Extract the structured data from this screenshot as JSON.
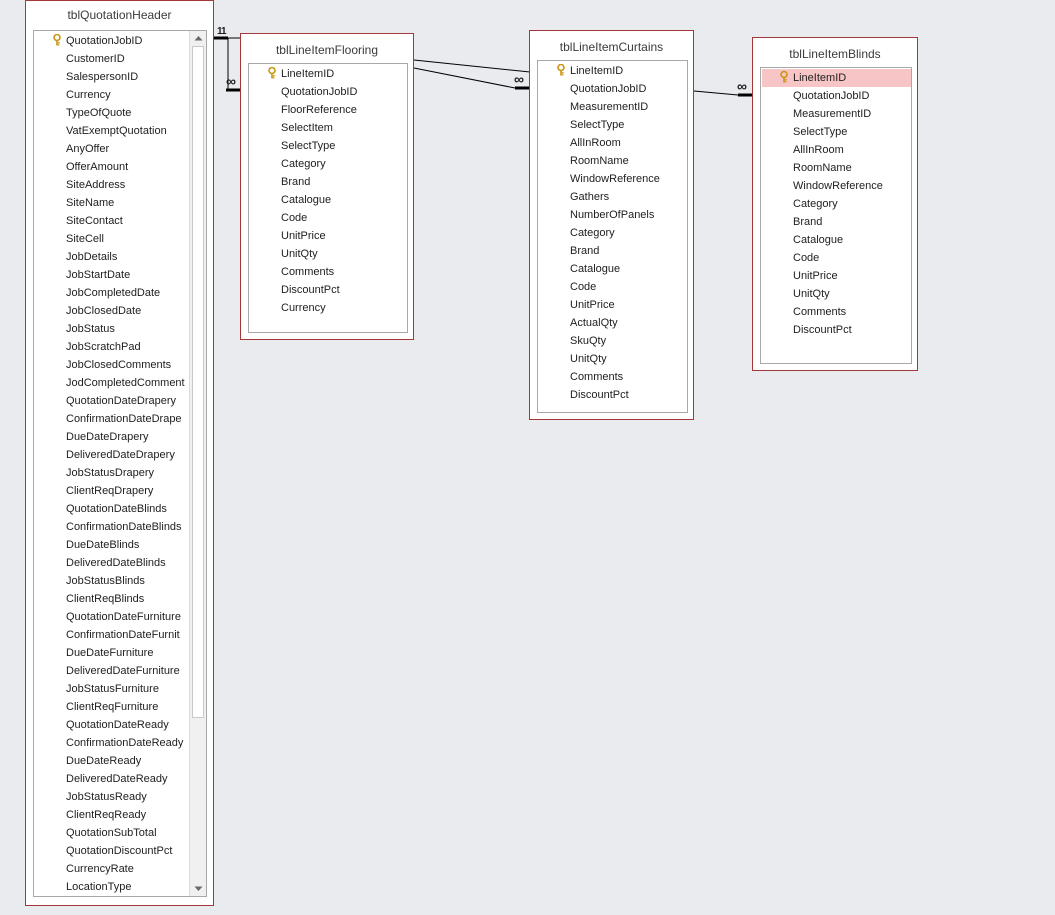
{
  "tables": [
    {
      "title": "tblQuotationHeader",
      "fields": [
        {
          "name": "QuotationJobID",
          "key": true
        },
        {
          "name": "CustomerID"
        },
        {
          "name": "SalespersonID"
        },
        {
          "name": "Currency"
        },
        {
          "name": "TypeOfQuote"
        },
        {
          "name": "VatExemptQuotation"
        },
        {
          "name": "AnyOffer"
        },
        {
          "name": "OfferAmount"
        },
        {
          "name": "SiteAddress"
        },
        {
          "name": "SiteName"
        },
        {
          "name": "SiteContact"
        },
        {
          "name": "SiteCell"
        },
        {
          "name": "JobDetails"
        },
        {
          "name": "JobStartDate"
        },
        {
          "name": "JobCompletedDate"
        },
        {
          "name": "JobClosedDate"
        },
        {
          "name": "JobStatus"
        },
        {
          "name": "JobScratchPad"
        },
        {
          "name": "JobClosedComments"
        },
        {
          "name": "JodCompletedComment"
        },
        {
          "name": "QuotationDateDrapery"
        },
        {
          "name": "ConfirmationDateDrape"
        },
        {
          "name": "DueDateDrapery"
        },
        {
          "name": "DeliveredDateDrapery"
        },
        {
          "name": "JobStatusDrapery"
        },
        {
          "name": "ClientReqDrapery"
        },
        {
          "name": "QuotationDateBlinds"
        },
        {
          "name": "ConfirmationDateBlinds"
        },
        {
          "name": "DueDateBlinds"
        },
        {
          "name": "DeliveredDateBlinds"
        },
        {
          "name": "JobStatusBlinds"
        },
        {
          "name": "ClientReqBlinds"
        },
        {
          "name": "QuotationDateFurniture"
        },
        {
          "name": "ConfirmationDateFurnit"
        },
        {
          "name": "DueDateFurniture"
        },
        {
          "name": "DeliveredDateFurniture"
        },
        {
          "name": "JobStatusFurniture"
        },
        {
          "name": "ClientReqFurniture"
        },
        {
          "name": "QuotationDateReady"
        },
        {
          "name": "ConfirmationDateReady"
        },
        {
          "name": "DueDateReady"
        },
        {
          "name": "DeliveredDateReady"
        },
        {
          "name": "JobStatusReady"
        },
        {
          "name": "ClientReqReady"
        },
        {
          "name": "QuotationSubTotal"
        },
        {
          "name": "QuotationDiscountPct"
        },
        {
          "name": "CurrencyRate"
        },
        {
          "name": "LocationType"
        }
      ]
    },
    {
      "title": "tblLineItemFlooring",
      "fields": [
        {
          "name": "LineItemID",
          "key": true
        },
        {
          "name": "QuotationJobID"
        },
        {
          "name": "FloorReference"
        },
        {
          "name": "SelectItem"
        },
        {
          "name": "SelectType"
        },
        {
          "name": "Category"
        },
        {
          "name": "Brand"
        },
        {
          "name": "Catalogue"
        },
        {
          "name": "Code"
        },
        {
          "name": "UnitPrice"
        },
        {
          "name": "UnitQty"
        },
        {
          "name": "Comments"
        },
        {
          "name": "DiscountPct"
        },
        {
          "name": "Currency"
        }
      ]
    },
    {
      "title": "tblLineItemCurtains",
      "fields": [
        {
          "name": "LineItemID",
          "key": true
        },
        {
          "name": "QuotationJobID"
        },
        {
          "name": "MeasurementID"
        },
        {
          "name": "SelectType"
        },
        {
          "name": "AllInRoom"
        },
        {
          "name": "RoomName"
        },
        {
          "name": "WindowReference"
        },
        {
          "name": "Gathers"
        },
        {
          "name": "NumberOfPanels"
        },
        {
          "name": "Category"
        },
        {
          "name": "Brand"
        },
        {
          "name": "Catalogue"
        },
        {
          "name": "Code"
        },
        {
          "name": "UnitPrice"
        },
        {
          "name": "ActualQty"
        },
        {
          "name": "SkuQty"
        },
        {
          "name": "UnitQty"
        },
        {
          "name": "Comments"
        },
        {
          "name": "DiscountPct"
        }
      ]
    },
    {
      "title": "tblLineItemBlinds",
      "fields": [
        {
          "name": "LineItemID",
          "key": true,
          "selected": true
        },
        {
          "name": "QuotationJobID"
        },
        {
          "name": "MeasurementID"
        },
        {
          "name": "SelectType"
        },
        {
          "name": "AllInRoom"
        },
        {
          "name": "RoomName"
        },
        {
          "name": "WindowReference"
        },
        {
          "name": "Category"
        },
        {
          "name": "Brand"
        },
        {
          "name": "Catalogue"
        },
        {
          "name": "Code"
        },
        {
          "name": "UnitPrice"
        },
        {
          "name": "UnitQty"
        },
        {
          "name": "Comments"
        },
        {
          "name": "DiscountPct"
        }
      ]
    }
  ],
  "relationship_labels": {
    "one": "1",
    "many": "∞"
  },
  "colors": {
    "table_border": "#a4373a",
    "selected_row": "#f7c5c6",
    "key_icon": "#d6a418",
    "canvas": "#e9ebef"
  },
  "icons": {
    "primary_key": "key-icon",
    "scroll_up": "chevron-up-icon",
    "scroll_down": "chevron-down-icon"
  }
}
